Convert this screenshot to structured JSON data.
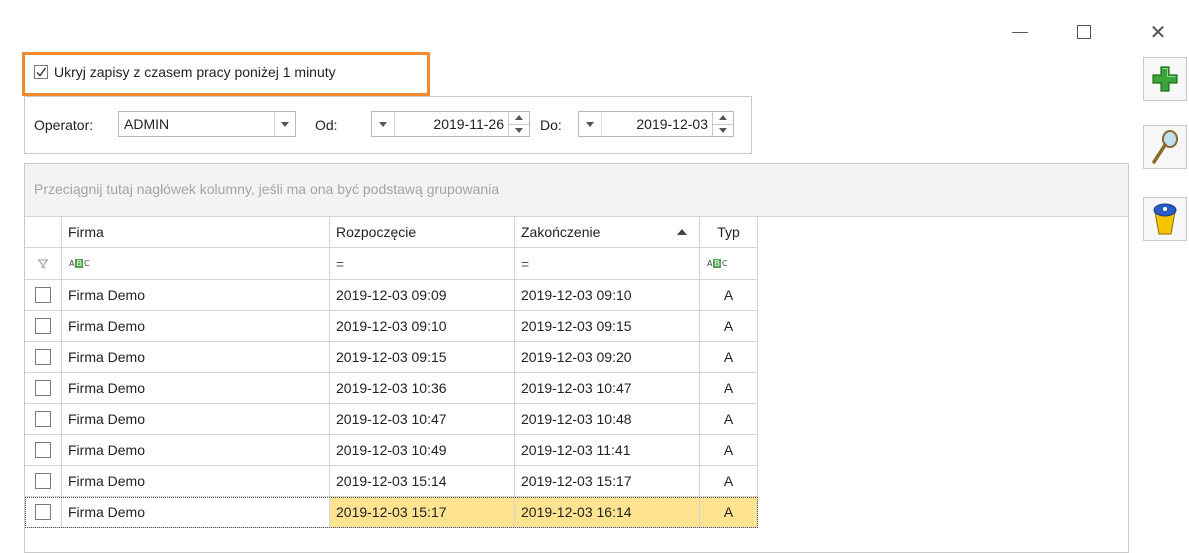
{
  "window": {
    "minimize_icon": "minimize-icon",
    "maximize_icon": "maximize-icon",
    "close_icon": "close-icon",
    "close_glyph": "✕"
  },
  "hide_records": {
    "checked": true,
    "label": "Ukryj zapisy z czasem pracy poniżej 1 minuty",
    "highlight_color": "#f08a2c"
  },
  "filters": {
    "operator_label": "Operator:",
    "operator_value": "ADMIN",
    "from_label": "Od:",
    "from_value": "2019-11-26",
    "to_label": "Do:",
    "to_value": "2019-12-03"
  },
  "grid": {
    "group_panel_text": "Przeciągnij tutaj nagłówek kolumny, jeśli ma ona być podstawą grupowania",
    "columns": [
      "Firma",
      "Rozpoczęcie",
      "Zakończenie",
      "Typ"
    ],
    "sorted_column": "Zakończenie",
    "sort_direction": "ascending",
    "filter_row": {
      "firma": "ABC",
      "rozpoczecie": "=",
      "zakonczenie": "=",
      "typ": "ABC"
    },
    "rows": [
      {
        "firma": "Firma Demo",
        "start": "2019-12-03 09:09",
        "end": "2019-12-03 09:10",
        "typ": "A"
      },
      {
        "firma": "Firma Demo",
        "start": "2019-12-03 09:10",
        "end": "2019-12-03 09:15",
        "typ": "A"
      },
      {
        "firma": "Firma Demo",
        "start": "2019-12-03 09:15",
        "end": "2019-12-03 09:20",
        "typ": "A"
      },
      {
        "firma": "Firma Demo",
        "start": "2019-12-03 10:36",
        "end": "2019-12-03 10:47",
        "typ": "A"
      },
      {
        "firma": "Firma Demo",
        "start": "2019-12-03 10:47",
        "end": "2019-12-03 10:48",
        "typ": "A"
      },
      {
        "firma": "Firma Demo",
        "start": "2019-12-03 10:49",
        "end": "2019-12-03 11:41",
        "typ": "A"
      },
      {
        "firma": "Firma Demo",
        "start": "2019-12-03 15:14",
        "end": "2019-12-03 15:17",
        "typ": "A"
      },
      {
        "firma": "Firma Demo",
        "start": "2019-12-03 15:17",
        "end": "2019-12-03 16:14",
        "typ": "A",
        "selected": true
      }
    ],
    "selected_row_color": "#ffe391"
  },
  "toolbar": {
    "add_icon": "add-plus-icon",
    "search_icon": "magnifier-icon",
    "delete_icon": "trash-bin-icon",
    "add_color": "#3aa63a"
  }
}
